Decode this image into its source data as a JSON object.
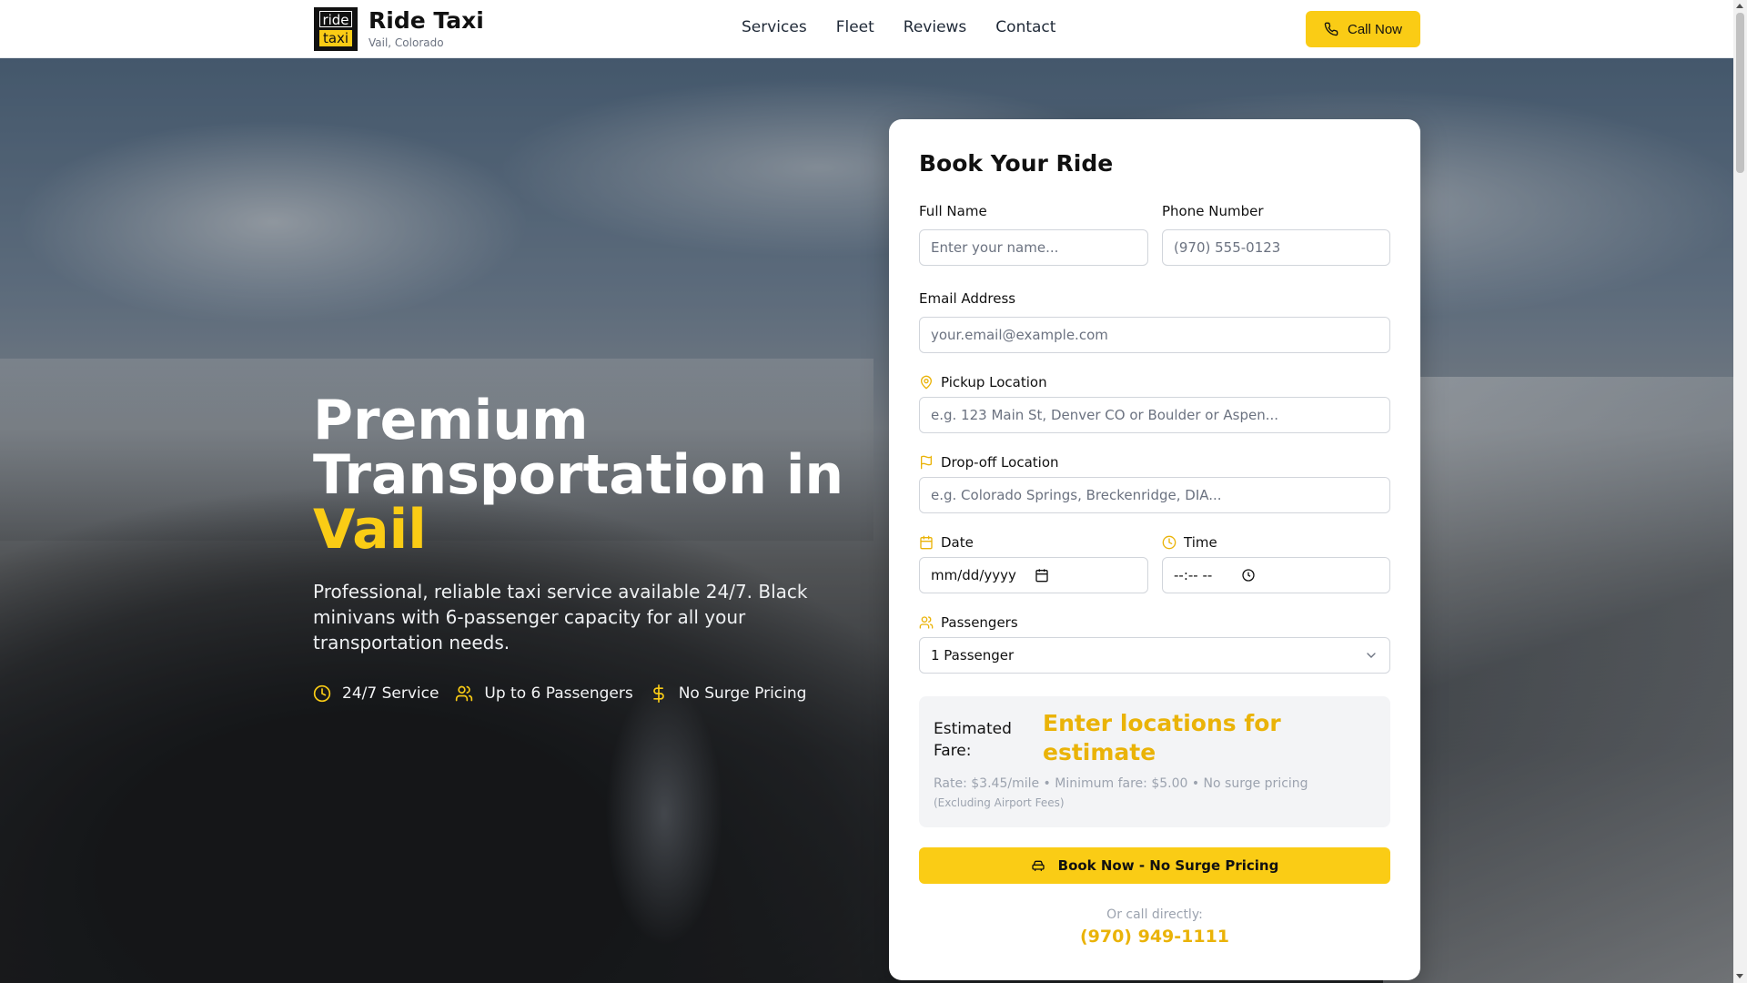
{
  "header": {
    "logo": {
      "line1": "ride",
      "line2": "taxi"
    },
    "brand_name": "Ride Taxi",
    "brand_location": "Vail, Colorado",
    "nav": [
      "Services",
      "Fleet",
      "Reviews",
      "Contact"
    ],
    "call_button": "Call Now"
  },
  "hero": {
    "title_line1": "Premium",
    "title_line2": "Transportation in",
    "title_accent": "Vail",
    "description": "Professional, reliable taxi service available 24/7. Black minivans with 6-passenger capacity for all your transportation needs.",
    "features": [
      {
        "icon": "clock-icon",
        "label": "24/7 Service"
      },
      {
        "icon": "users-icon",
        "label": "Up to 6 Passengers"
      },
      {
        "icon": "dollar-icon",
        "label": "No Surge Pricing"
      }
    ]
  },
  "booking": {
    "title": "Book Your Ride",
    "full_name": {
      "label": "Full Name",
      "placeholder": "Enter your name...",
      "value": ""
    },
    "phone": {
      "label": "Phone Number",
      "placeholder": "(970) 555-0123",
      "value": ""
    },
    "email": {
      "label": "Email Address",
      "placeholder": "your.email@example.com",
      "value": ""
    },
    "pickup": {
      "label": "Pickup Location",
      "placeholder": "e.g. 123 Main St, Denver CO or Boulder or Aspen...",
      "icon": "map-pin-icon"
    },
    "dropoff": {
      "label": "Drop-off Location",
      "placeholder": "e.g. Colorado Springs, Breckenridge, DIA...",
      "icon": "flag-icon"
    },
    "date": {
      "label": "Date",
      "display": "mm/dd/yyyy",
      "icon": "calendar-icon"
    },
    "time": {
      "label": "Time",
      "display": "--:-- --",
      "icon": "clock-icon"
    },
    "passengers": {
      "label": "Passengers",
      "selected": "1 Passenger",
      "icon": "users-icon"
    },
    "fare": {
      "label": "Estimated Fare:",
      "value": "Enter locations for estimate",
      "rate": "Rate: $3.45/mile • Minimum fare: $5.00 • No surge pricing",
      "note": "(Excluding Airport Fees)"
    },
    "book_button": "Book Now - No Surge Pricing",
    "or_call": "Or call directly:",
    "phone_number": "(970) 949-1111"
  },
  "colors": {
    "accent": "#facc15",
    "accent_text": "#eab308",
    "muted": "#9ca3af"
  }
}
